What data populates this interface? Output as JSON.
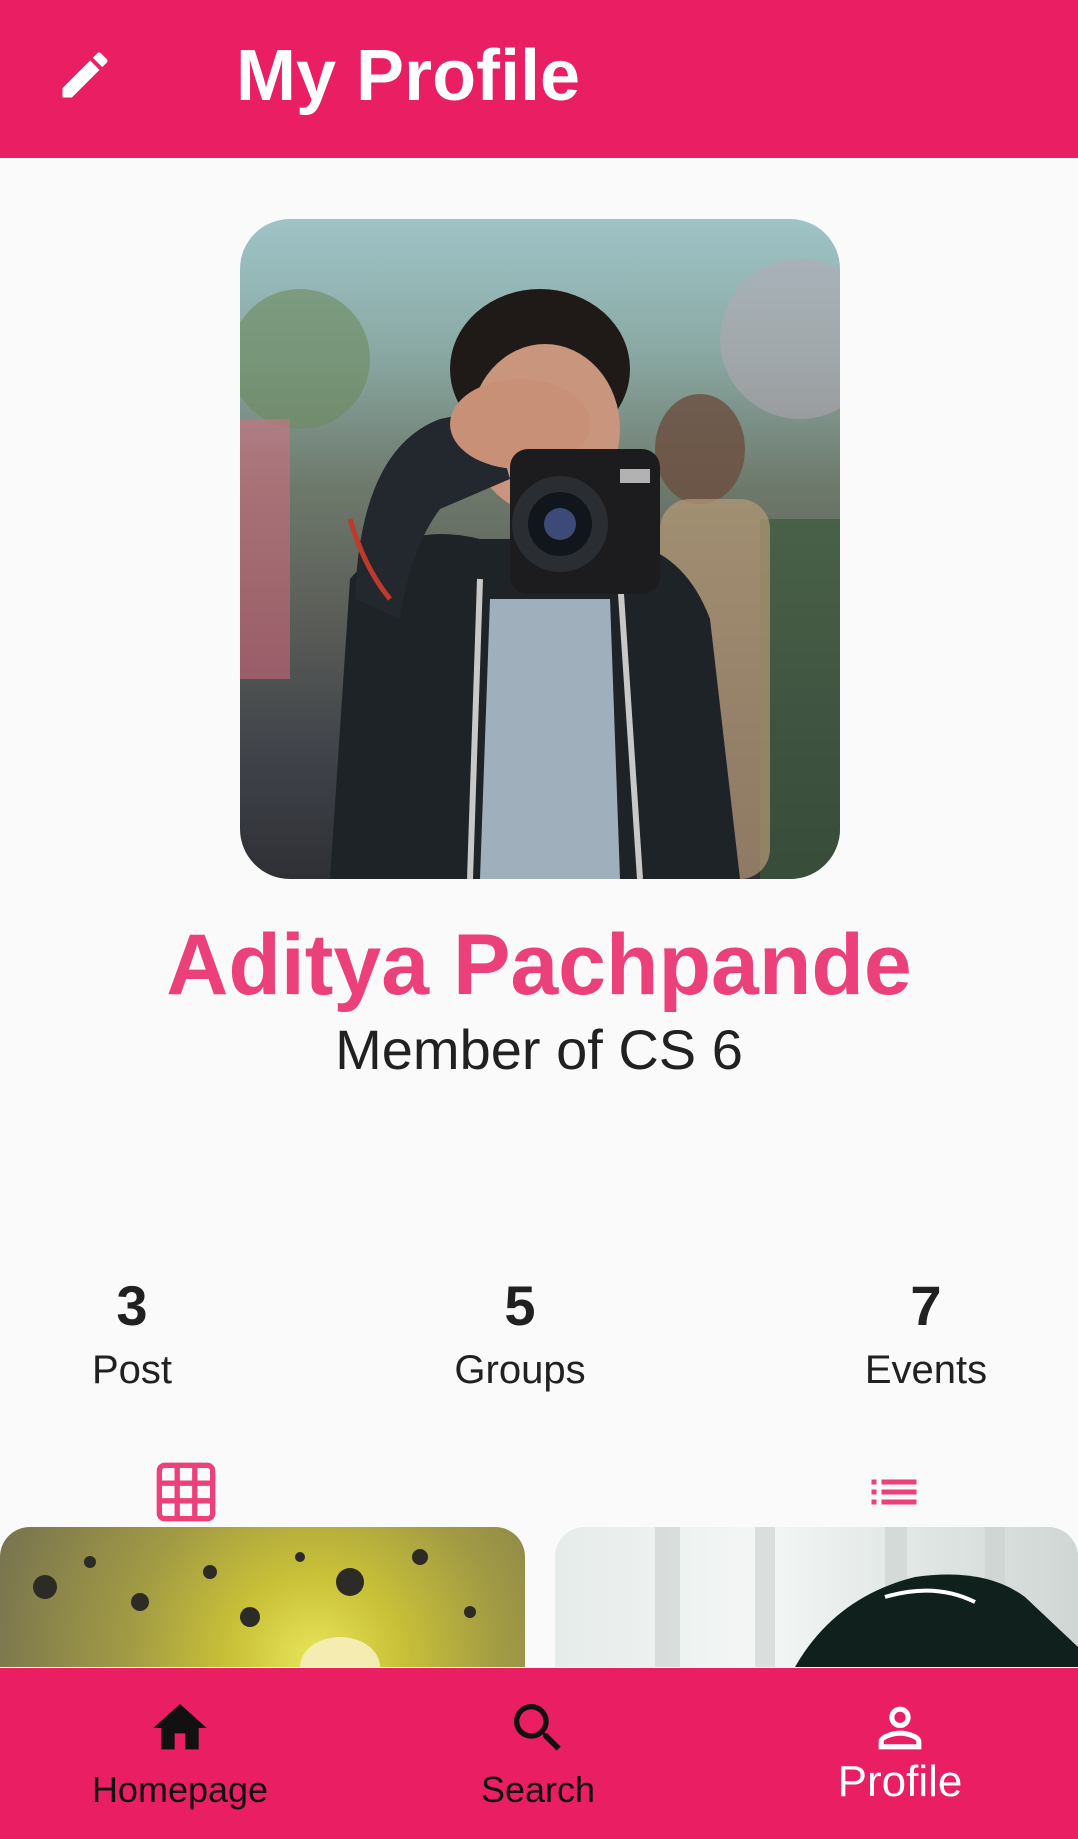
{
  "appbar": {
    "title": "My Profile",
    "edit_icon": "pencil-icon",
    "background": "#e91e63"
  },
  "profile": {
    "name": "Aditya Pachpande",
    "subtitle": "Member of CS 6",
    "name_color": "#ec407a"
  },
  "stats": [
    {
      "value": "3",
      "label": "Post"
    },
    {
      "value": "5",
      "label": "Groups"
    },
    {
      "value": "7",
      "label": "Events"
    }
  ],
  "view_toggles": [
    {
      "icon": "grid-icon"
    },
    {
      "icon": "list-icon"
    }
  ],
  "nav": {
    "items": [
      {
        "label": "Homepage",
        "icon": "home-icon"
      },
      {
        "label": "Search",
        "icon": "search-icon"
      },
      {
        "label": "Profile",
        "icon": "person-icon",
        "active": true
      }
    ]
  }
}
